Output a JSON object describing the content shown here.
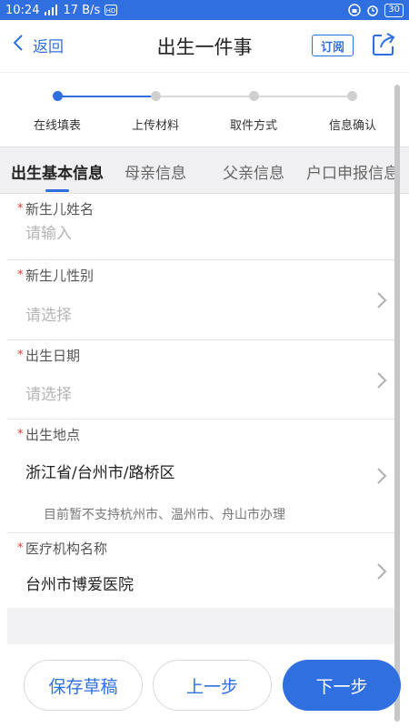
{
  "status_bar": {
    "time": "10:24",
    "network_speed": "17 B/s",
    "battery": "30"
  },
  "nav": {
    "back_label": "返回",
    "title": "出生一件事",
    "subscribe_label": "订阅",
    "share_icon": "share-icon"
  },
  "stepper": {
    "steps": [
      {
        "label": "在线填表",
        "active": true
      },
      {
        "label": "上传材料",
        "active": false
      },
      {
        "label": "取件方式",
        "active": false
      },
      {
        "label": "信息确认",
        "active": false
      }
    ],
    "active_color": "#2f6fe0",
    "inactive_color": "#d0d0d0"
  },
  "tabs": [
    {
      "label": "出生基本信息",
      "active": true
    },
    {
      "label": "母亲信息",
      "active": false
    },
    {
      "label": "父亲信息",
      "active": false
    },
    {
      "label": "户口申报信息",
      "active": false
    }
  ],
  "form": {
    "required_mark": "*",
    "fields": [
      {
        "label": "新生儿姓名",
        "value": "",
        "placeholder": "请输入"
      },
      {
        "label": "新生儿性别",
        "value": "",
        "placeholder": "请选择"
      },
      {
        "label": "出生日期",
        "value": "",
        "placeholder": "请选择"
      },
      {
        "label": "出生地点",
        "value": "浙江省/台州市/路桥区",
        "note": "目前暂不支持杭州市、温州市、舟山市办理"
      },
      {
        "label": "医疗机构名称",
        "value": "台州市博爱医院"
      }
    ]
  },
  "buttons": {
    "save_draft": "保存草稿",
    "previous": "上一步",
    "next": "下一步"
  },
  "colors": {
    "primary": "#2f6fe0",
    "required": "#e53935"
  }
}
